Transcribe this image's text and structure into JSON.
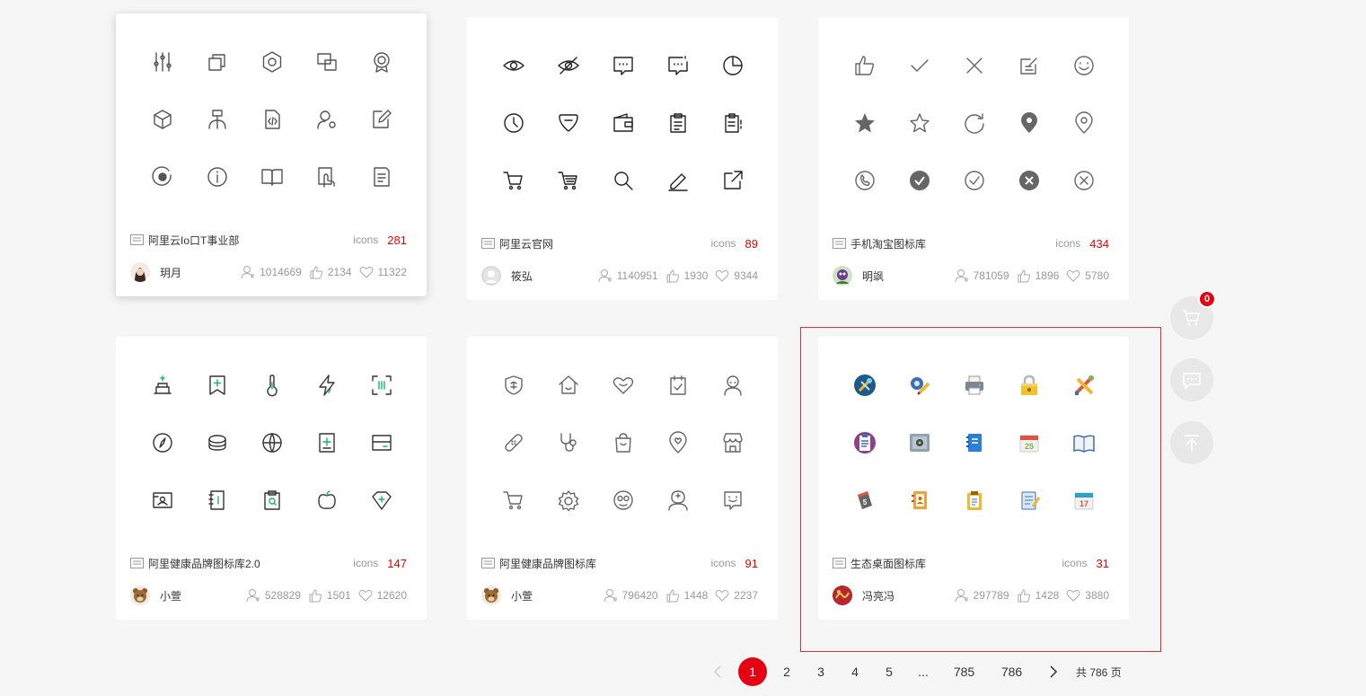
{
  "cards": [
    {
      "library_name": "阿里云Io口T事业部",
      "icons_label": "icons",
      "icon_count": "281",
      "author": "玥月",
      "views": "1014669",
      "likes": "2134",
      "favorites": "11322",
      "icons": [
        "sliders-icon",
        "copy-icon",
        "hexagon-icon",
        "devices-icon",
        "award-icon",
        "cube-icon",
        "network-icon",
        "code-file-icon",
        "user-settings-icon",
        "edit-note-icon",
        "record-icon",
        "info-icon",
        "book-icon",
        "touch-icon",
        "document-icon"
      ],
      "icon_color": "#555555"
    },
    {
      "library_name": "阿里云官网",
      "icons_label": "icons",
      "icon_count": "89",
      "author": "筱弘",
      "views": "1140951",
      "likes": "1930",
      "favorites": "9344",
      "icons": [
        "eye-icon",
        "eye-off-icon",
        "comment-icon",
        "comment-dots-icon",
        "pie-chart-icon",
        "clock-icon",
        "tag-icon",
        "wallet-icon",
        "clipboard-icon",
        "clipboard-list-icon",
        "cart-icon",
        "cart-full-icon",
        "search-icon",
        "edit-icon",
        "external-link-icon"
      ],
      "icon_color": "#222222"
    },
    {
      "library_name": "手机淘宝图标库",
      "icons_label": "icons",
      "icon_count": "434",
      "author": "明飒",
      "views": "781059",
      "likes": "1896",
      "favorites": "5780",
      "icons": [
        "thumbs-up-icon",
        "check-icon",
        "close-icon",
        "edit-square-icon",
        "smile-icon",
        "star-filled-icon",
        "star-icon",
        "refresh-icon",
        "location-filled-icon",
        "location-icon",
        "phone-icon",
        "check-circle-filled-icon",
        "check-circle-icon",
        "close-circle-filled-icon",
        "close-circle-icon"
      ],
      "icon_color": "#666666"
    },
    {
      "library_name": "阿里健康品牌图标库2.0",
      "icons_label": "icons",
      "icon_count": "147",
      "author": "小萱",
      "views": "528829",
      "likes": "1501",
      "favorites": "12620",
      "icons": [
        "cake-icon",
        "bookmark-plus-icon",
        "thermometer-icon",
        "lightning-icon",
        "scan-icon",
        "compass-icon",
        "pill-stack-icon",
        "ball-icon",
        "medical-doc-icon",
        "card-icon",
        "id-card-icon",
        "notebook-icon",
        "clipboard-search-icon",
        "apple-icon",
        "diamond-plus-icon"
      ],
      "icon_color": "#333333",
      "accent_color": "#1ab36b"
    },
    {
      "library_name": "阿里健康品牌图标库",
      "icons_label": "icons",
      "icon_count": "91",
      "author": "小萱",
      "views": "796420",
      "likes": "1448",
      "favorites": "2237",
      "icons": [
        "shield-icon",
        "home-icon",
        "heart-icon",
        "calendar-check-icon",
        "doctor-icon",
        "bandage-icon",
        "stethoscope-icon",
        "bag-icon",
        "location-heart-icon",
        "store-icon",
        "cart-icon",
        "gear-icon",
        "face-icon",
        "nurse-icon",
        "chat-smile-icon"
      ],
      "icon_color": "#666666"
    },
    {
      "library_name": "生态桌面图标库",
      "icons_label": "icons",
      "icon_count": "31",
      "author": "冯亮冯",
      "views": "297789",
      "likes": "1428",
      "favorites": "3880",
      "icons": [
        "tools-circle-icon",
        "settings-pen-icon",
        "printer-icon",
        "lock-icon",
        "tools-cross-icon",
        "checklist-icon",
        "safe-icon",
        "contacts-icon",
        "calendar-25-icon",
        "open-book-icon",
        "calendar-5-icon",
        "address-book-icon",
        "clipboard-color-icon",
        "notepad-icon",
        "calendar-17-icon"
      ],
      "icon_color": "#4a90c8"
    }
  ],
  "floating": {
    "cart_badge": "0"
  },
  "pagination": {
    "pages": [
      "1",
      "2",
      "3",
      "4",
      "5",
      "...",
      "785",
      "786"
    ],
    "active": "1",
    "total": "共 786 页"
  },
  "colors": {
    "accent": "#e60012",
    "count": "#ee0000",
    "highlight_border": "#e0303a"
  }
}
